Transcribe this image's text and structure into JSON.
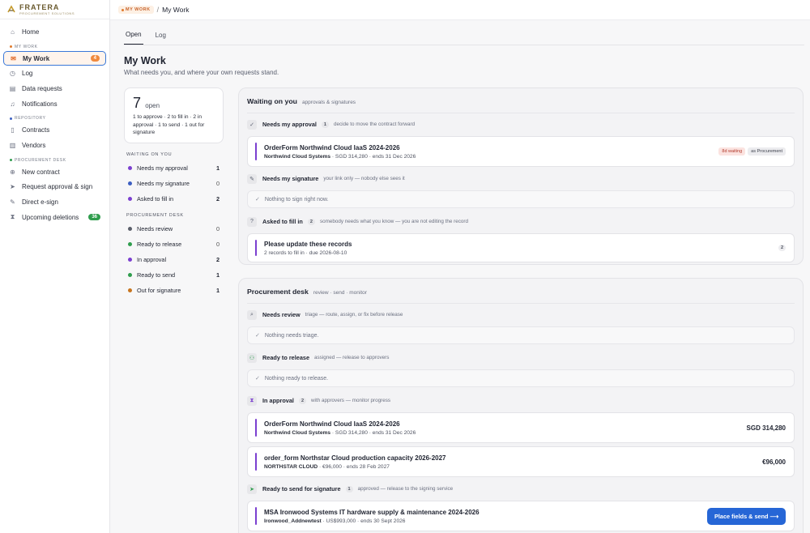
{
  "brand": {
    "name": "FRATERA",
    "tagline": "PROCUREMENT SOLUTIONS"
  },
  "sidebar": {
    "home": "Home",
    "section_mywork": "MY WORK",
    "my_work": "My Work",
    "my_work_count": "4",
    "log": "Log",
    "data_requests": "Data requests",
    "notifications": "Notifications",
    "section_repository": "REPOSITORY",
    "contracts": "Contracts",
    "vendors": "Vendors",
    "section_procurement": "PROCUREMENT DESK",
    "new_contract": "New contract",
    "request_approval": "Request approval & sign",
    "direct_esign": "Direct e-sign",
    "upcoming_deletions": "Upcoming deletions",
    "upcoming_deletions_count": "36"
  },
  "topbar": {
    "chip": "MY WORK",
    "sep": "/",
    "page": "My Work"
  },
  "tabs": {
    "open": "Open",
    "log": "Log"
  },
  "header": {
    "title": "My Work",
    "subtitle": "What needs you, and where your own requests stand."
  },
  "summary": {
    "total": "7",
    "total_label": "open",
    "line": "1 to approve · 2 to fill in · 2 in approval · 1 to send · 1 out for signature"
  },
  "waiting_counts": {
    "title": "WAITING ON YOU",
    "rows": [
      {
        "label": "Needs my approval",
        "value": "1",
        "color": "#7b3fd0"
      },
      {
        "label": "Needs my signature",
        "value": "0",
        "color": "#3d5fc2"
      },
      {
        "label": "Asked to fill in",
        "value": "2",
        "color": "#7b3fd0"
      }
    ]
  },
  "desk_counts": {
    "title": "PROCUREMENT DESK",
    "rows": [
      {
        "label": "Needs review",
        "value": "0",
        "color": "#5a5e6a"
      },
      {
        "label": "Ready to release",
        "value": "0",
        "color": "#2f9d4d"
      },
      {
        "label": "In approval",
        "value": "2",
        "color": "#7b3fd0"
      },
      {
        "label": "Ready to send",
        "value": "1",
        "color": "#2f9d4d"
      },
      {
        "label": "Out for signature",
        "value": "1",
        "color": "#c7751f"
      }
    ]
  },
  "waiting_panel": {
    "title": "Waiting on you",
    "hint": "approvals & signatures",
    "approval": {
      "label": "Needs my approval",
      "badge": "1",
      "desc": "decide to move the contract forward",
      "item": {
        "title": "OrderForm Northwind Cloud IaaS 2024-2026",
        "vendor": "Northwind Cloud Systems",
        "meta": " · SGD 314,280 · ends 31 Dec 2026",
        "tag1": "8d waiting",
        "tag2": "as Procurement"
      }
    },
    "signature": {
      "label": "Needs my signature",
      "desc": "your link only — nobody else sees it",
      "empty": "Nothing to sign right now."
    },
    "fill": {
      "label": "Asked to fill in",
      "badge": "2",
      "desc": "somebody needs what you know — you are not editing the record",
      "item": {
        "title": "Please update these records",
        "meta": "2 records to fill in · due 2026-08-10",
        "badge": "2"
      }
    }
  },
  "desk_panel": {
    "title": "Procurement desk",
    "hint": "review · send · monitor",
    "review": {
      "label": "Needs review",
      "desc": "triage — route, assign, or fix before release",
      "empty": "Nothing needs triage."
    },
    "release": {
      "label": "Ready to release",
      "desc": "assigned — release to approvers",
      "empty": "Nothing ready to release."
    },
    "approval": {
      "label": "In approval",
      "badge": "2",
      "desc": "with approvers — monitor progress",
      "item1": {
        "title": "OrderForm Northwind Cloud IaaS 2024-2026",
        "vendor": "Northwind Cloud Systems",
        "meta": " · SGD 314,280 · ends 31 Dec 2026",
        "amount": "SGD 314,280"
      },
      "item2": {
        "title": "order_form Northstar Cloud production capacity 2026-2027",
        "vendor": "NORTHSTAR CLOUD",
        "meta": " · €96,000 · ends 28 Feb 2027",
        "amount": "€96,000"
      }
    },
    "send": {
      "label": "Ready to send for signature",
      "badge": "1",
      "desc": "approved — release to the signing service",
      "item": {
        "title": "MSA Ironwood Systems IT hardware supply & maintenance 2024-2026",
        "vendor": "Ironwood_Addnewtest",
        "meta": " · US$993,000 · ends 30 Sept 2026",
        "button": "Place fields & send ⟶"
      }
    }
  }
}
